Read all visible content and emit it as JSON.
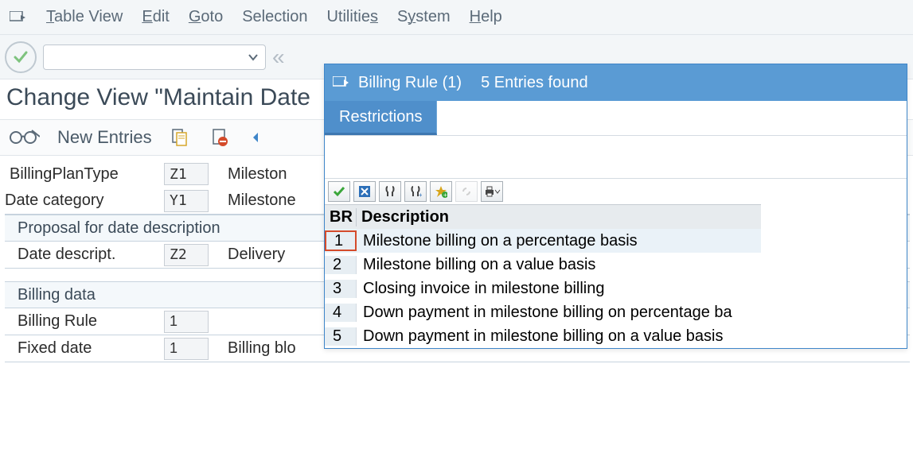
{
  "menubar": {
    "items": [
      "Table View",
      "Edit",
      "Goto",
      "Selection",
      "Utilities",
      "System",
      "Help"
    ]
  },
  "page_title": "Change View \"Maintain Date",
  "new_entries_label": "New Entries",
  "form": {
    "billing_plan_type_label": "BillingPlanType",
    "billing_plan_type_value": "Z1",
    "milestone_partial": "Mileston",
    "date_category_label": "Date category",
    "date_category_value": "Y1",
    "milestone_text": "Milestone",
    "proposal_header": "Proposal for date description",
    "date_descript_label": "Date descript.",
    "date_descript_value": "Z2",
    "delivery_partial": "Delivery ",
    "billing_data_header": "Billing data",
    "billing_rule_label": "Billing Rule",
    "billing_rule_value": "1",
    "fixed_date_label": "Fixed date",
    "fixed_date_value": "1",
    "billing_block_partial": "Billing blo"
  },
  "popup": {
    "title_prefix": "Billing Rule (1)",
    "title_status": "5 Entries found",
    "tab_label": "Restrictions",
    "columns": {
      "br": "BR",
      "desc": "Description"
    },
    "rows": [
      {
        "br": "1",
        "desc": "Milestone billing on a percentage basis",
        "selected": true
      },
      {
        "br": "2",
        "desc": "Milestone billing on a value basis",
        "selected": false
      },
      {
        "br": "3",
        "desc": "Closing invoice in milestone billing",
        "selected": false
      },
      {
        "br": "4",
        "desc": "Down payment in milestone billing on percentage ba",
        "selected": false
      },
      {
        "br": "5",
        "desc": "Down payment in milestone billing on a value basis",
        "selected": false
      }
    ]
  }
}
